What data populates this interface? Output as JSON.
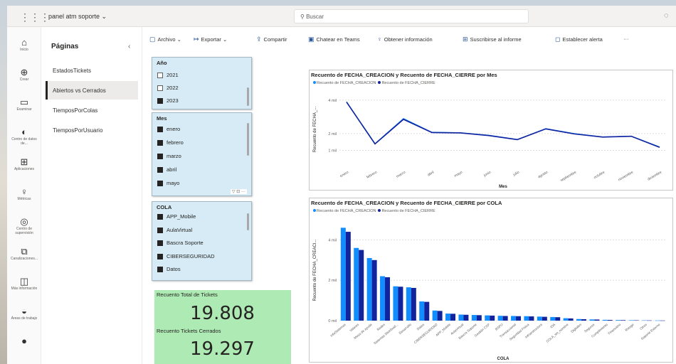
{
  "app": {
    "workspace": "panel atm soporte",
    "search_placeholder": "Buscar"
  },
  "rail": [
    {
      "icon": "home-icon",
      "glyph": "⌂",
      "label": "Inicio"
    },
    {
      "icon": "create-icon",
      "glyph": "⊕",
      "label": "Crear"
    },
    {
      "icon": "browse-icon",
      "glyph": "▭",
      "label": "Examinar"
    },
    {
      "icon": "data-hub-icon",
      "glyph": "◐",
      "label": "Centro de datos de..."
    },
    {
      "icon": "apps-icon",
      "glyph": "⊞",
      "label": "Aplicaciones"
    },
    {
      "icon": "metrics-icon",
      "glyph": "♀",
      "label": "Métricas"
    },
    {
      "icon": "monitor-icon",
      "glyph": "◎",
      "label": "Centro de supervisión"
    },
    {
      "icon": "deployment-icon",
      "glyph": "⧉",
      "label": "Canalizaciones..."
    },
    {
      "icon": "learn-icon",
      "glyph": "◫",
      "label": "Más información"
    },
    {
      "icon": "workspaces-icon",
      "glyph": "◒",
      "label": "Áreas de trabajo"
    },
    {
      "icon": "account-icon",
      "glyph": "●",
      "label": ""
    }
  ],
  "pages": {
    "title": "Páginas",
    "items": [
      "EstadosTickets",
      "Abiertos vs Cerrados",
      "TiemposPorColas",
      "TiemposPorUsuario"
    ],
    "active_index": 1
  },
  "toolbar": {
    "archivo": "Archivo",
    "exportar": "Exportar",
    "compartir": "Compartir",
    "teams": "Chatear en Teams",
    "insights": "Obtener información",
    "subscribe": "Suscribirse al informe",
    "alert": "Establecer alerta",
    "more": "···"
  },
  "slicers": {
    "anio": {
      "title": "Año",
      "options": [
        {
          "label": "2021",
          "checked": false
        },
        {
          "label": "2022",
          "checked": false
        },
        {
          "label": "2023",
          "checked": true
        }
      ]
    },
    "mes": {
      "title": "Mes",
      "options": [
        {
          "label": "enero",
          "checked": true
        },
        {
          "label": "febrero",
          "checked": true
        },
        {
          "label": "marzo",
          "checked": true
        },
        {
          "label": "abril",
          "checked": true
        },
        {
          "label": "mayo",
          "checked": true
        }
      ],
      "footer": "▽ ⊡ ···"
    },
    "cola": {
      "title": "COLA",
      "options": [
        {
          "label": "APP_Mobile",
          "checked": true
        },
        {
          "label": "AulaVirtual",
          "checked": true
        },
        {
          "label": "Bascra Soporte",
          "checked": true
        },
        {
          "label": "CIBERSEGURIDAD",
          "checked": true
        },
        {
          "label": "Datos",
          "checked": true
        }
      ]
    }
  },
  "kpis": {
    "total_label": "Recuento Total de Tickets",
    "total_value": "19.808",
    "closed_label": "Recuento Tickets Cerrados",
    "closed_value": "19.297"
  },
  "colors": {
    "creation": "#118dff",
    "closing": "#12239e",
    "kpi_bg": "#aeeab3",
    "slicer_bg": "#d6ebf5"
  },
  "chart_data": [
    {
      "type": "line",
      "title": "Recuento de FECHA_CREACION y Recuento de FECHA_CIERRE por Mes",
      "xlabel": "Mes",
      "ylabel": "Recuento de FECHA_...",
      "categories": [
        "enero",
        "febrero",
        "marzo",
        "abril",
        "mayo",
        "junio",
        "julio",
        "agosto",
        "septiembre",
        "octubre",
        "noviembre",
        "diciembre"
      ],
      "series": [
        {
          "name": "Recuento de FECHA_CREACION",
          "values": [
            3900,
            1400,
            2900,
            2080,
            2050,
            1900,
            1650,
            2300,
            2000,
            1800,
            1850,
            1200
          ]
        },
        {
          "name": "Recuento de FECHA_CIERRE",
          "values": [
            3880,
            1380,
            2850,
            2060,
            2040,
            1880,
            1640,
            2280,
            1980,
            1790,
            1840,
            1180
          ]
        }
      ],
      "yticks": [
        "1 mil",
        "2 mil",
        "4 mil"
      ],
      "ytick_values": [
        1000,
        2000,
        4000
      ],
      "ylim": [
        0,
        4500
      ],
      "grid": true,
      "legend": "top-left"
    },
    {
      "type": "bar",
      "title": "Recuento de FECHA_CREACION y Recuento de FECHA_CIERRE por COLA",
      "xlabel": "COLA",
      "ylabel": "Recuento de FECHA_CREACI...",
      "categories": [
        "InfoSistemas",
        "Valores",
        "Mesa de ayuda",
        "Redes",
        "Sistemas Distribuid...",
        "Desarrollo",
        "Datos",
        "CIBERSEGURIDAD",
        "APP_Mobile",
        "AulaVirtual",
        "Bascra Soporte",
        "Gestión CXP",
        "BSPU",
        "Transaccional",
        "Seguridad Física",
        "Infraestructura",
        "IDA",
        "COLA_sin_nombre",
        "Digitales",
        "Seguros",
        "Cumplimiento",
        "Financiero",
        "Riesgo",
        "Otros",
        "Soporte Externo"
      ],
      "series": [
        {
          "name": "Recuento de FECHA_CREACION",
          "values": [
            4600,
            3600,
            3100,
            2200,
            1700,
            1650,
            950,
            500,
            350,
            300,
            280,
            260,
            240,
            230,
            220,
            200,
            180,
            120,
            80,
            60,
            40,
            30,
            20,
            15,
            10
          ]
        },
        {
          "name": "Recuento de FECHA_CIERRE",
          "values": [
            4400,
            3500,
            3000,
            2150,
            1680,
            1620,
            930,
            480,
            340,
            290,
            270,
            250,
            230,
            220,
            210,
            190,
            170,
            110,
            70,
            55,
            35,
            25,
            18,
            12,
            8
          ]
        }
      ],
      "yticks": [
        "0 mil",
        "2 mil",
        "4 mil"
      ],
      "ytick_values": [
        0,
        2000,
        4000
      ],
      "ylim": [
        0,
        5000
      ],
      "grid": true,
      "legend": "top-left"
    }
  ]
}
